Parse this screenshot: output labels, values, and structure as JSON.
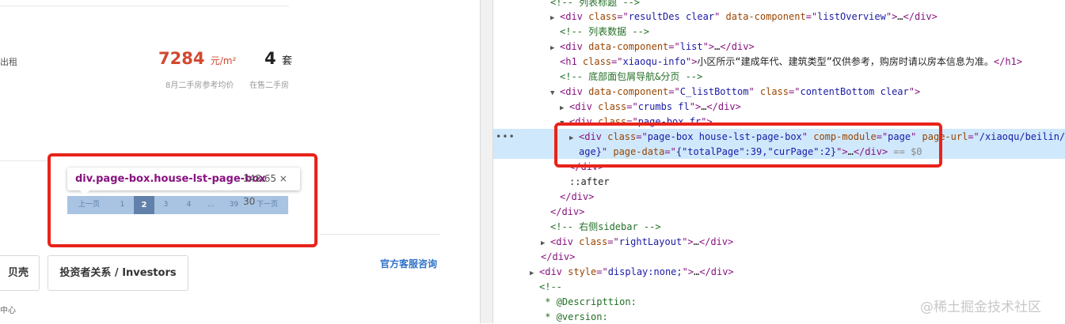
{
  "left_page": {
    "rent_fragment": "出租",
    "avg_price": "7284",
    "avg_price_unit": "元/m²",
    "avg_price_caption": "8月二手房参考均价",
    "listing_count": "4",
    "listing_count_unit": "套",
    "listing_count_caption": "在售二手房",
    "pagination": [
      "上一页",
      "1",
      "2",
      "3",
      "4",
      "...",
      "39",
      "下一页"
    ],
    "current_page": "2",
    "footer_btn_left": "贝壳",
    "footer_btn_investors": "投资者关系 / Investors",
    "service_link": "官方客服咨询",
    "footer_fragment": "中心"
  },
  "inspector_tooltip": {
    "selector": "div.page-box.house-lst-page-box",
    "size": "348.65 × 30"
  },
  "devtools": {
    "selected_dots": "•••",
    "watermark": "@稀土掘金技术社区"
  },
  "colors": {
    "price_red": "#d2482f",
    "link_blue": "#3072c8",
    "annotation_red": "#e8231b",
    "selection_bg": "#cfe8fc",
    "pager_bg": "#a9c3e2",
    "pager_current": "#6281aa"
  }
}
